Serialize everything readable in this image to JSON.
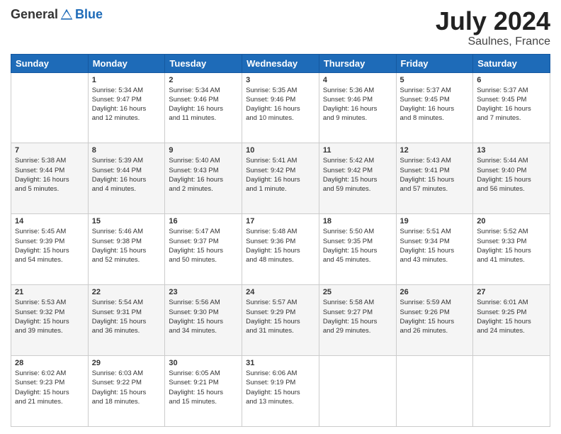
{
  "header": {
    "logo_general": "General",
    "logo_blue": "Blue",
    "month_year": "July 2024",
    "location": "Saulnes, France"
  },
  "days_of_week": [
    "Sunday",
    "Monday",
    "Tuesday",
    "Wednesday",
    "Thursday",
    "Friday",
    "Saturday"
  ],
  "weeks": [
    [
      {
        "day": "",
        "content": ""
      },
      {
        "day": "1",
        "content": "Sunrise: 5:34 AM\nSunset: 9:47 PM\nDaylight: 16 hours\nand 12 minutes."
      },
      {
        "day": "2",
        "content": "Sunrise: 5:34 AM\nSunset: 9:46 PM\nDaylight: 16 hours\nand 11 minutes."
      },
      {
        "day": "3",
        "content": "Sunrise: 5:35 AM\nSunset: 9:46 PM\nDaylight: 16 hours\nand 10 minutes."
      },
      {
        "day": "4",
        "content": "Sunrise: 5:36 AM\nSunset: 9:46 PM\nDaylight: 16 hours\nand 9 minutes."
      },
      {
        "day": "5",
        "content": "Sunrise: 5:37 AM\nSunset: 9:45 PM\nDaylight: 16 hours\nand 8 minutes."
      },
      {
        "day": "6",
        "content": "Sunrise: 5:37 AM\nSunset: 9:45 PM\nDaylight: 16 hours\nand 7 minutes."
      }
    ],
    [
      {
        "day": "7",
        "content": "Sunrise: 5:38 AM\nSunset: 9:44 PM\nDaylight: 16 hours\nand 5 minutes."
      },
      {
        "day": "8",
        "content": "Sunrise: 5:39 AM\nSunset: 9:44 PM\nDaylight: 16 hours\nand 4 minutes."
      },
      {
        "day": "9",
        "content": "Sunrise: 5:40 AM\nSunset: 9:43 PM\nDaylight: 16 hours\nand 2 minutes."
      },
      {
        "day": "10",
        "content": "Sunrise: 5:41 AM\nSunset: 9:42 PM\nDaylight: 16 hours\nand 1 minute."
      },
      {
        "day": "11",
        "content": "Sunrise: 5:42 AM\nSunset: 9:42 PM\nDaylight: 15 hours\nand 59 minutes."
      },
      {
        "day": "12",
        "content": "Sunrise: 5:43 AM\nSunset: 9:41 PM\nDaylight: 15 hours\nand 57 minutes."
      },
      {
        "day": "13",
        "content": "Sunrise: 5:44 AM\nSunset: 9:40 PM\nDaylight: 15 hours\nand 56 minutes."
      }
    ],
    [
      {
        "day": "14",
        "content": "Sunrise: 5:45 AM\nSunset: 9:39 PM\nDaylight: 15 hours\nand 54 minutes."
      },
      {
        "day": "15",
        "content": "Sunrise: 5:46 AM\nSunset: 9:38 PM\nDaylight: 15 hours\nand 52 minutes."
      },
      {
        "day": "16",
        "content": "Sunrise: 5:47 AM\nSunset: 9:37 PM\nDaylight: 15 hours\nand 50 minutes."
      },
      {
        "day": "17",
        "content": "Sunrise: 5:48 AM\nSunset: 9:36 PM\nDaylight: 15 hours\nand 48 minutes."
      },
      {
        "day": "18",
        "content": "Sunrise: 5:50 AM\nSunset: 9:35 PM\nDaylight: 15 hours\nand 45 minutes."
      },
      {
        "day": "19",
        "content": "Sunrise: 5:51 AM\nSunset: 9:34 PM\nDaylight: 15 hours\nand 43 minutes."
      },
      {
        "day": "20",
        "content": "Sunrise: 5:52 AM\nSunset: 9:33 PM\nDaylight: 15 hours\nand 41 minutes."
      }
    ],
    [
      {
        "day": "21",
        "content": "Sunrise: 5:53 AM\nSunset: 9:32 PM\nDaylight: 15 hours\nand 39 minutes."
      },
      {
        "day": "22",
        "content": "Sunrise: 5:54 AM\nSunset: 9:31 PM\nDaylight: 15 hours\nand 36 minutes."
      },
      {
        "day": "23",
        "content": "Sunrise: 5:56 AM\nSunset: 9:30 PM\nDaylight: 15 hours\nand 34 minutes."
      },
      {
        "day": "24",
        "content": "Sunrise: 5:57 AM\nSunset: 9:29 PM\nDaylight: 15 hours\nand 31 minutes."
      },
      {
        "day": "25",
        "content": "Sunrise: 5:58 AM\nSunset: 9:27 PM\nDaylight: 15 hours\nand 29 minutes."
      },
      {
        "day": "26",
        "content": "Sunrise: 5:59 AM\nSunset: 9:26 PM\nDaylight: 15 hours\nand 26 minutes."
      },
      {
        "day": "27",
        "content": "Sunrise: 6:01 AM\nSunset: 9:25 PM\nDaylight: 15 hours\nand 24 minutes."
      }
    ],
    [
      {
        "day": "28",
        "content": "Sunrise: 6:02 AM\nSunset: 9:23 PM\nDaylight: 15 hours\nand 21 minutes."
      },
      {
        "day": "29",
        "content": "Sunrise: 6:03 AM\nSunset: 9:22 PM\nDaylight: 15 hours\nand 18 minutes."
      },
      {
        "day": "30",
        "content": "Sunrise: 6:05 AM\nSunset: 9:21 PM\nDaylight: 15 hours\nand 15 minutes."
      },
      {
        "day": "31",
        "content": "Sunrise: 6:06 AM\nSunset: 9:19 PM\nDaylight: 15 hours\nand 13 minutes."
      },
      {
        "day": "",
        "content": ""
      },
      {
        "day": "",
        "content": ""
      },
      {
        "day": "",
        "content": ""
      }
    ]
  ]
}
